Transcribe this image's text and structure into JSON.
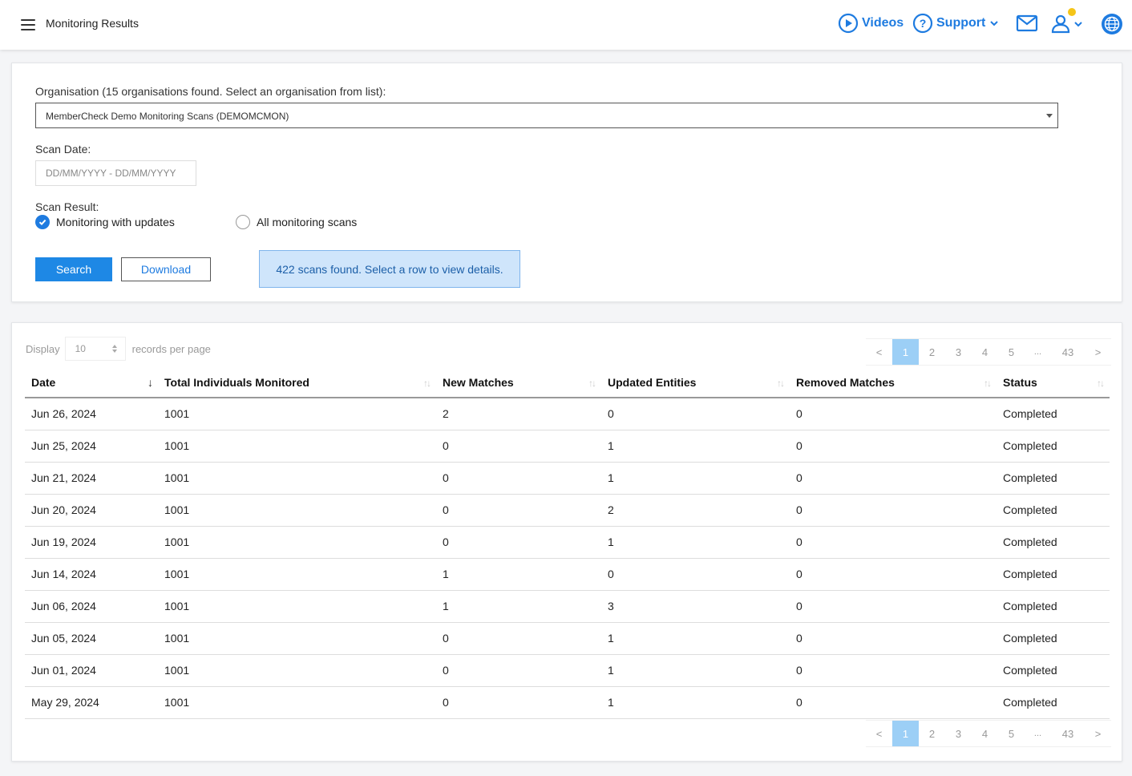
{
  "header": {
    "title": "Monitoring Results",
    "videos_label": "Videos",
    "support_label": "Support"
  },
  "filters": {
    "org_label": "Organisation (15 organisations found. Select an organisation from list):",
    "org_selected": "MemberCheck Demo Monitoring Scans (DEMOMCMON)",
    "scan_date_label": "Scan Date:",
    "scan_date_placeholder": "DD/MM/YYYY - DD/MM/YYYY",
    "scan_result_label": "Scan Result:",
    "radio_updates": "Monitoring with updates",
    "radio_all": "All monitoring scans",
    "search_button": "Search",
    "download_button": "Download",
    "info_message": "422 scans found. Select a row to view details."
  },
  "table": {
    "display_label": "Display",
    "page_size": "10",
    "records_label": "records per page",
    "pagination": [
      "<",
      "1",
      "2",
      "3",
      "4",
      "5",
      "...",
      "43",
      ">"
    ],
    "columns": [
      "Date",
      "Total Individuals Monitored",
      "New Matches",
      "Updated Entities",
      "Removed Matches",
      "Status"
    ],
    "rows": [
      [
        "Jun 26, 2024",
        "1001",
        "2",
        "0",
        "0",
        "Completed"
      ],
      [
        "Jun 25, 2024",
        "1001",
        "0",
        "1",
        "0",
        "Completed"
      ],
      [
        "Jun 21, 2024",
        "1001",
        "0",
        "1",
        "0",
        "Completed"
      ],
      [
        "Jun 20, 2024",
        "1001",
        "0",
        "2",
        "0",
        "Completed"
      ],
      [
        "Jun 19, 2024",
        "1001",
        "0",
        "1",
        "0",
        "Completed"
      ],
      [
        "Jun 14, 2024",
        "1001",
        "1",
        "0",
        "0",
        "Completed"
      ],
      [
        "Jun 06, 2024",
        "1001",
        "1",
        "3",
        "0",
        "Completed"
      ],
      [
        "Jun 05, 2024",
        "1001",
        "0",
        "1",
        "0",
        "Completed"
      ],
      [
        "Jun 01, 2024",
        "1001",
        "0",
        "1",
        "0",
        "Completed"
      ],
      [
        "May 29, 2024",
        "1001",
        "0",
        "1",
        "0",
        "Completed"
      ]
    ]
  },
  "colors": {
    "accent": "#1e7be0",
    "active_page": "#9ccff6",
    "info_bg": "#cfe5fb",
    "notification": "#f5c518"
  }
}
